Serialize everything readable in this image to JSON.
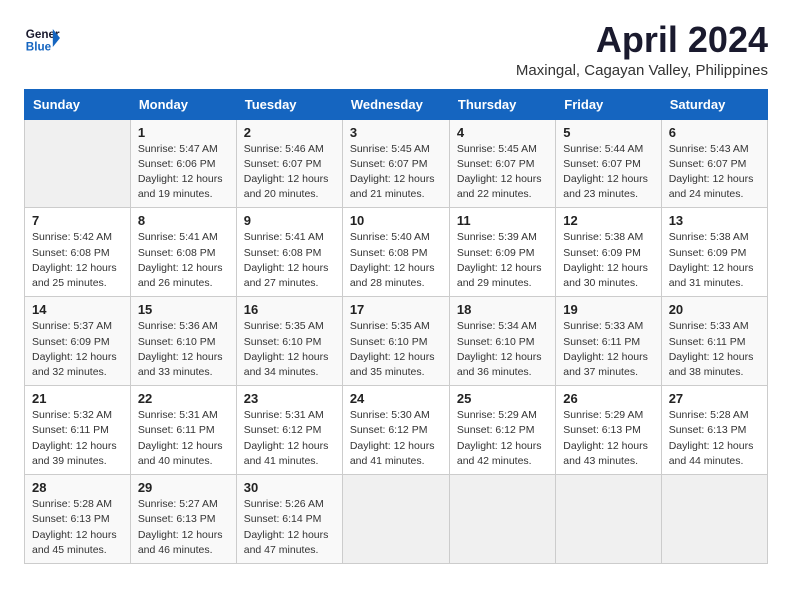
{
  "header": {
    "logo_line1": "General",
    "logo_line2": "Blue",
    "title": "April 2024",
    "subtitle": "Maxingal, Cagayan Valley, Philippines"
  },
  "weekdays": [
    "Sunday",
    "Monday",
    "Tuesday",
    "Wednesday",
    "Thursday",
    "Friday",
    "Saturday"
  ],
  "weeks": [
    [
      {
        "day": "",
        "detail": ""
      },
      {
        "day": "1",
        "detail": "Sunrise: 5:47 AM\nSunset: 6:06 PM\nDaylight: 12 hours\nand 19 minutes."
      },
      {
        "day": "2",
        "detail": "Sunrise: 5:46 AM\nSunset: 6:07 PM\nDaylight: 12 hours\nand 20 minutes."
      },
      {
        "day": "3",
        "detail": "Sunrise: 5:45 AM\nSunset: 6:07 PM\nDaylight: 12 hours\nand 21 minutes."
      },
      {
        "day": "4",
        "detail": "Sunrise: 5:45 AM\nSunset: 6:07 PM\nDaylight: 12 hours\nand 22 minutes."
      },
      {
        "day": "5",
        "detail": "Sunrise: 5:44 AM\nSunset: 6:07 PM\nDaylight: 12 hours\nand 23 minutes."
      },
      {
        "day": "6",
        "detail": "Sunrise: 5:43 AM\nSunset: 6:07 PM\nDaylight: 12 hours\nand 24 minutes."
      }
    ],
    [
      {
        "day": "7",
        "detail": "Sunrise: 5:42 AM\nSunset: 6:08 PM\nDaylight: 12 hours\nand 25 minutes."
      },
      {
        "day": "8",
        "detail": "Sunrise: 5:41 AM\nSunset: 6:08 PM\nDaylight: 12 hours\nand 26 minutes."
      },
      {
        "day": "9",
        "detail": "Sunrise: 5:41 AM\nSunset: 6:08 PM\nDaylight: 12 hours\nand 27 minutes."
      },
      {
        "day": "10",
        "detail": "Sunrise: 5:40 AM\nSunset: 6:08 PM\nDaylight: 12 hours\nand 28 minutes."
      },
      {
        "day": "11",
        "detail": "Sunrise: 5:39 AM\nSunset: 6:09 PM\nDaylight: 12 hours\nand 29 minutes."
      },
      {
        "day": "12",
        "detail": "Sunrise: 5:38 AM\nSunset: 6:09 PM\nDaylight: 12 hours\nand 30 minutes."
      },
      {
        "day": "13",
        "detail": "Sunrise: 5:38 AM\nSunset: 6:09 PM\nDaylight: 12 hours\nand 31 minutes."
      }
    ],
    [
      {
        "day": "14",
        "detail": "Sunrise: 5:37 AM\nSunset: 6:09 PM\nDaylight: 12 hours\nand 32 minutes."
      },
      {
        "day": "15",
        "detail": "Sunrise: 5:36 AM\nSunset: 6:10 PM\nDaylight: 12 hours\nand 33 minutes."
      },
      {
        "day": "16",
        "detail": "Sunrise: 5:35 AM\nSunset: 6:10 PM\nDaylight: 12 hours\nand 34 minutes."
      },
      {
        "day": "17",
        "detail": "Sunrise: 5:35 AM\nSunset: 6:10 PM\nDaylight: 12 hours\nand 35 minutes."
      },
      {
        "day": "18",
        "detail": "Sunrise: 5:34 AM\nSunset: 6:10 PM\nDaylight: 12 hours\nand 36 minutes."
      },
      {
        "day": "19",
        "detail": "Sunrise: 5:33 AM\nSunset: 6:11 PM\nDaylight: 12 hours\nand 37 minutes."
      },
      {
        "day": "20",
        "detail": "Sunrise: 5:33 AM\nSunset: 6:11 PM\nDaylight: 12 hours\nand 38 minutes."
      }
    ],
    [
      {
        "day": "21",
        "detail": "Sunrise: 5:32 AM\nSunset: 6:11 PM\nDaylight: 12 hours\nand 39 minutes."
      },
      {
        "day": "22",
        "detail": "Sunrise: 5:31 AM\nSunset: 6:11 PM\nDaylight: 12 hours\nand 40 minutes."
      },
      {
        "day": "23",
        "detail": "Sunrise: 5:31 AM\nSunset: 6:12 PM\nDaylight: 12 hours\nand 41 minutes."
      },
      {
        "day": "24",
        "detail": "Sunrise: 5:30 AM\nSunset: 6:12 PM\nDaylight: 12 hours\nand 41 minutes."
      },
      {
        "day": "25",
        "detail": "Sunrise: 5:29 AM\nSunset: 6:12 PM\nDaylight: 12 hours\nand 42 minutes."
      },
      {
        "day": "26",
        "detail": "Sunrise: 5:29 AM\nSunset: 6:13 PM\nDaylight: 12 hours\nand 43 minutes."
      },
      {
        "day": "27",
        "detail": "Sunrise: 5:28 AM\nSunset: 6:13 PM\nDaylight: 12 hours\nand 44 minutes."
      }
    ],
    [
      {
        "day": "28",
        "detail": "Sunrise: 5:28 AM\nSunset: 6:13 PM\nDaylight: 12 hours\nand 45 minutes."
      },
      {
        "day": "29",
        "detail": "Sunrise: 5:27 AM\nSunset: 6:13 PM\nDaylight: 12 hours\nand 46 minutes."
      },
      {
        "day": "30",
        "detail": "Sunrise: 5:26 AM\nSunset: 6:14 PM\nDaylight: 12 hours\nand 47 minutes."
      },
      {
        "day": "",
        "detail": ""
      },
      {
        "day": "",
        "detail": ""
      },
      {
        "day": "",
        "detail": ""
      },
      {
        "day": "",
        "detail": ""
      }
    ]
  ]
}
